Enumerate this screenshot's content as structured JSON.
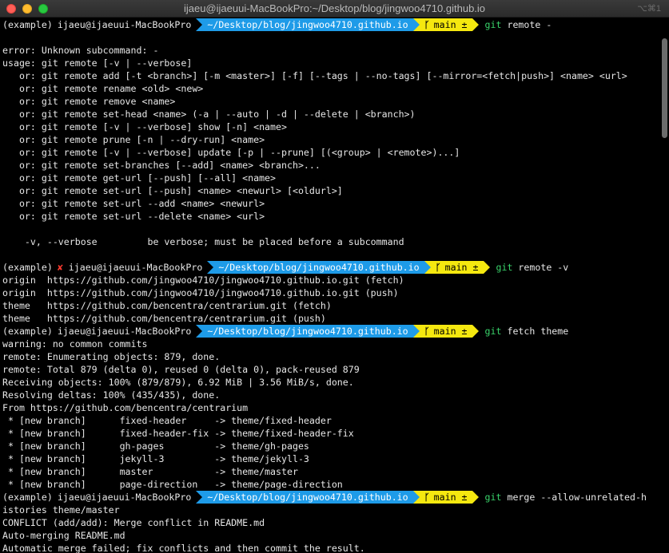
{
  "window": {
    "title": "ijaeu@ijaeuui-MacBookPro:~/Desktop/blog/jingwoo4710.github.io",
    "shortcut": "⌥⌘1"
  },
  "prompt": {
    "env": "(example)",
    "user_host": "ijaeu@ijaeuui-MacBookPro",
    "path": "~/Desktop/blog/jingwoo4710.github.io",
    "branch": "main ±",
    "error_mark": "✘"
  },
  "colors": {
    "path_bg": "#1e9be8",
    "git_bg": "#f5e80f",
    "command": "#39d36a",
    "error": "#ff3b30"
  },
  "icons": {
    "branch": "branch-icon"
  },
  "lines": [
    {
      "type": "prompt",
      "cmd": "git",
      "args": " remote -",
      "error": false
    },
    {
      "type": "text",
      "text": ""
    },
    {
      "type": "text",
      "text": "error: Unknown subcommand: -"
    },
    {
      "type": "text",
      "text": "usage: git remote [-v | --verbose]"
    },
    {
      "type": "text",
      "text": "   or: git remote add [-t <branch>] [-m <master>] [-f] [--tags | --no-tags] [--mirror=<fetch|push>] <name> <url>"
    },
    {
      "type": "text",
      "text": "   or: git remote rename <old> <new>"
    },
    {
      "type": "text",
      "text": "   or: git remote remove <name>"
    },
    {
      "type": "text",
      "text": "   or: git remote set-head <name> (-a | --auto | -d | --delete | <branch>)"
    },
    {
      "type": "text",
      "text": "   or: git remote [-v | --verbose] show [-n] <name>"
    },
    {
      "type": "text",
      "text": "   or: git remote prune [-n | --dry-run] <name>"
    },
    {
      "type": "text",
      "text": "   or: git remote [-v | --verbose] update [-p | --prune] [(<group> | <remote>)...]"
    },
    {
      "type": "text",
      "text": "   or: git remote set-branches [--add] <name> <branch>..."
    },
    {
      "type": "text",
      "text": "   or: git remote get-url [--push] [--all] <name>"
    },
    {
      "type": "text",
      "text": "   or: git remote set-url [--push] <name> <newurl> [<oldurl>]"
    },
    {
      "type": "text",
      "text": "   or: git remote set-url --add <name> <newurl>"
    },
    {
      "type": "text",
      "text": "   or: git remote set-url --delete <name> <url>"
    },
    {
      "type": "text",
      "text": ""
    },
    {
      "type": "text",
      "text": "    -v, --verbose         be verbose; must be placed before a subcommand"
    },
    {
      "type": "text",
      "text": ""
    },
    {
      "type": "prompt",
      "cmd": "git",
      "args": " remote -v",
      "error": true
    },
    {
      "type": "text",
      "text": "origin  https://github.com/jingwoo4710/jingwoo4710.github.io.git (fetch)"
    },
    {
      "type": "text",
      "text": "origin  https://github.com/jingwoo4710/jingwoo4710.github.io.git (push)"
    },
    {
      "type": "text",
      "text": "theme   https://github.com/bencentra/centrarium.git (fetch)"
    },
    {
      "type": "text",
      "text": "theme   https://github.com/bencentra/centrarium.git (push)"
    },
    {
      "type": "prompt",
      "cmd": "git",
      "args": " fetch theme",
      "error": false
    },
    {
      "type": "text",
      "text": "warning: no common commits"
    },
    {
      "type": "text",
      "text": "remote: Enumerating objects: 879, done."
    },
    {
      "type": "text",
      "text": "remote: Total 879 (delta 0), reused 0 (delta 0), pack-reused 879"
    },
    {
      "type": "text",
      "text": "Receiving objects: 100% (879/879), 6.92 MiB | 3.56 MiB/s, done."
    },
    {
      "type": "text",
      "text": "Resolving deltas: 100% (435/435), done."
    },
    {
      "type": "text",
      "text": "From https://github.com/bencentra/centrarium"
    },
    {
      "type": "text",
      "text": " * [new branch]      fixed-header     -> theme/fixed-header"
    },
    {
      "type": "text",
      "text": " * [new branch]      fixed-header-fix -> theme/fixed-header-fix"
    },
    {
      "type": "text",
      "text": " * [new branch]      gh-pages         -> theme/gh-pages"
    },
    {
      "type": "text",
      "text": " * [new branch]      jekyll-3         -> theme/jekyll-3"
    },
    {
      "type": "text",
      "text": " * [new branch]      master           -> theme/master"
    },
    {
      "type": "text",
      "text": " * [new branch]      page-direction   -> theme/page-direction"
    },
    {
      "type": "prompt",
      "cmd": "git",
      "args": " merge --allow-unrelated-h",
      "error": false
    },
    {
      "type": "text",
      "text": "istories theme/master"
    },
    {
      "type": "text",
      "text": "CONFLICT (add/add): Merge conflict in README.md"
    },
    {
      "type": "text",
      "text": "Auto-merging README.md"
    },
    {
      "type": "text",
      "text": "Automatic merge failed; fix conflicts and then commit the result."
    }
  ]
}
